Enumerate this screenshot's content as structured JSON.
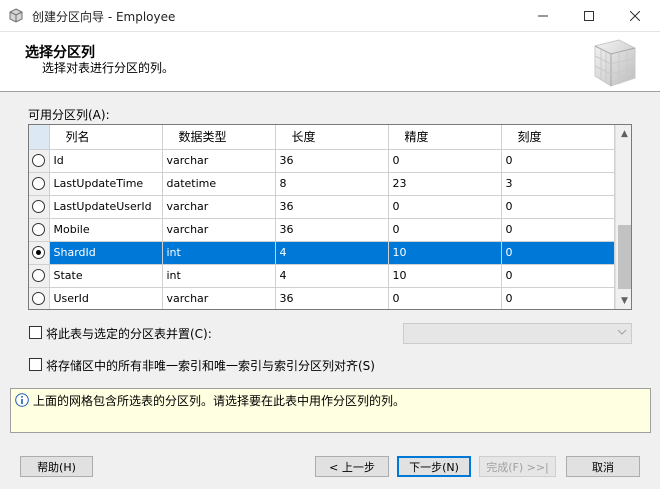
{
  "window": {
    "title": "创建分区向导 - Employee",
    "minimize": "—",
    "maximize": "☐",
    "close": "✕"
  },
  "header": {
    "title": "选择分区列",
    "subtitle": "选择对表进行分区的列。",
    "graphic": "cube-graphic"
  },
  "grid": {
    "label": "可用分区列(A):",
    "columns": [
      "列名",
      "数据类型",
      "长度",
      "精度",
      "刻度"
    ],
    "rows": [
      {
        "selected": false,
        "name": "Id",
        "type": "varchar",
        "length": "36",
        "precision": "0",
        "scale": "0"
      },
      {
        "selected": false,
        "name": "LastUpdateTime",
        "type": "datetime",
        "length": "8",
        "precision": "23",
        "scale": "3"
      },
      {
        "selected": false,
        "name": "LastUpdateUserId",
        "type": "varchar",
        "length": "36",
        "precision": "0",
        "scale": "0"
      },
      {
        "selected": false,
        "name": "Mobile",
        "type": "varchar",
        "length": "36",
        "precision": "0",
        "scale": "0"
      },
      {
        "selected": true,
        "name": "ShardId",
        "type": "int",
        "length": "4",
        "precision": "10",
        "scale": "0"
      },
      {
        "selected": false,
        "name": "State",
        "type": "int",
        "length": "4",
        "precision": "10",
        "scale": "0"
      },
      {
        "selected": false,
        "name": "UserId",
        "type": "varchar",
        "length": "36",
        "precision": "0",
        "scale": "0"
      }
    ],
    "scroll_up": "▲",
    "scroll_down": "▼"
  },
  "options": {
    "collocate_label": "将此表与选定的分区表并置(C):",
    "collocate_checked": false,
    "collocate_combo_value": "",
    "align_label": "将存储区中的所有非唯一索引和唯一索引与索引分区列对齐(S)",
    "align_checked": false
  },
  "info": {
    "icon": "info-icon",
    "text": "上面的网格包含所选表的分区列。请选择要在此表中用作分区列的列。"
  },
  "buttons": {
    "help": "帮助(H)",
    "back": "< 上一步",
    "next": "下一步(N)",
    "finish": "完成(F) >>|",
    "cancel": "取消"
  },
  "colors": {
    "selection": "#0078d7",
    "info_bg": "#ffffe1",
    "header_bg": "#ffffff"
  }
}
